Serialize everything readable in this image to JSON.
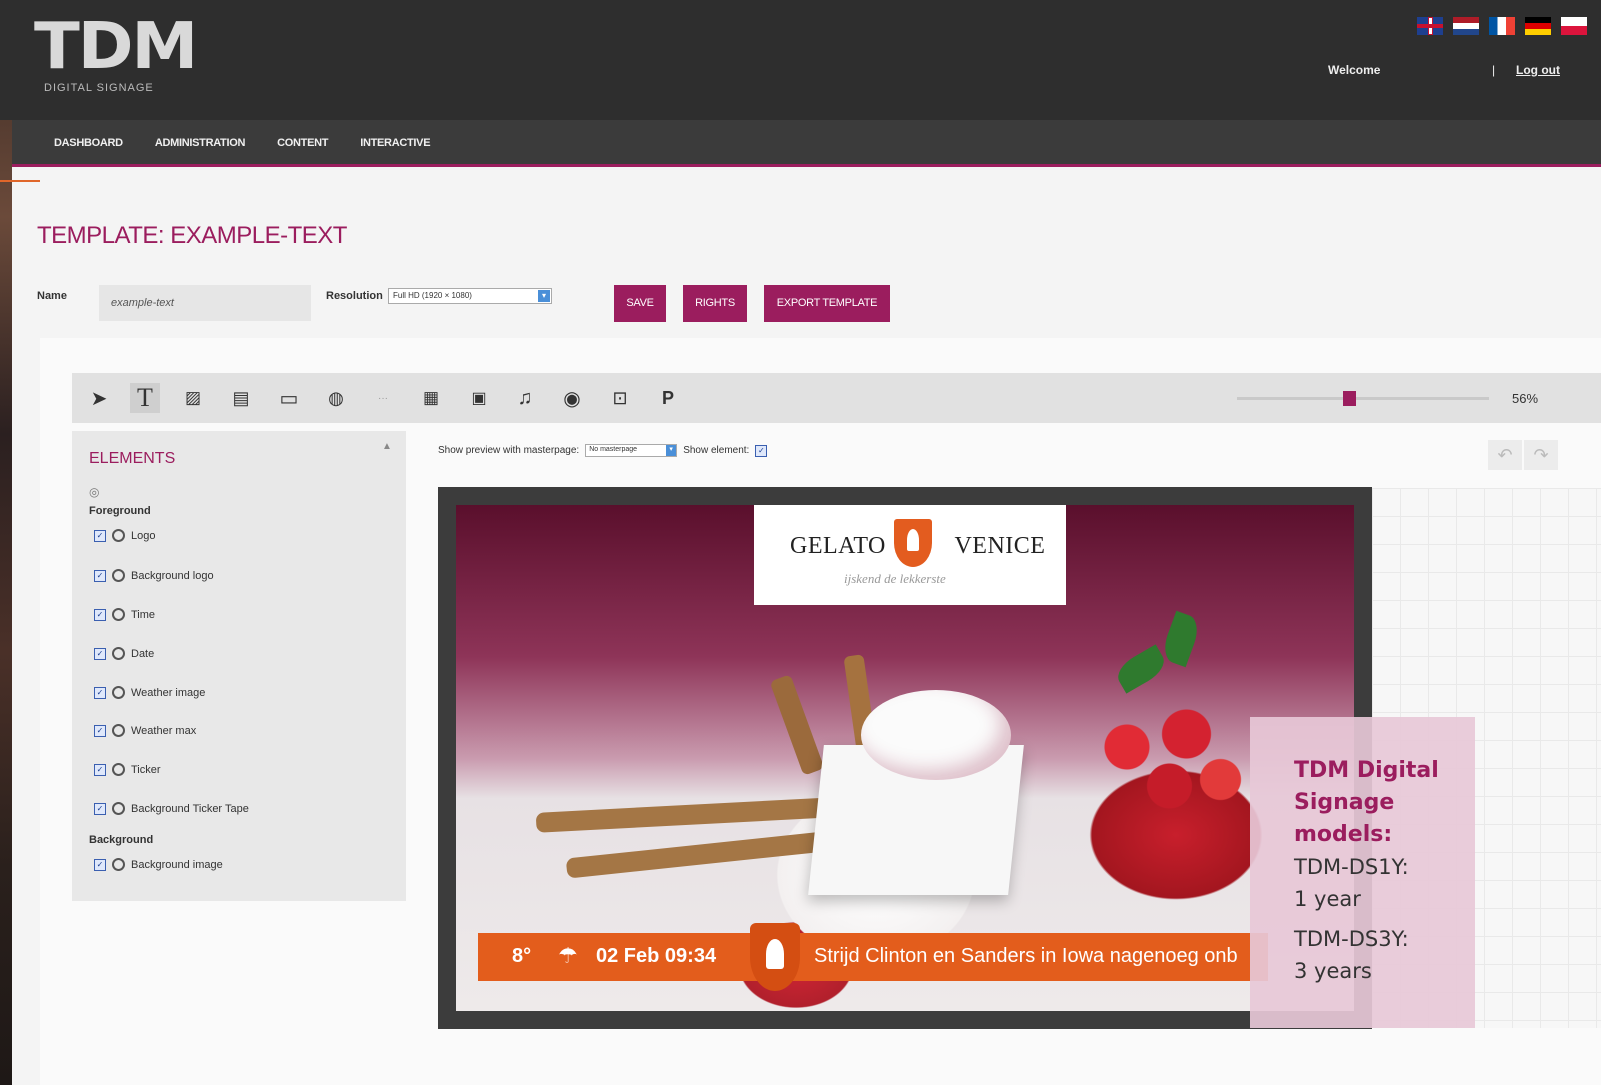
{
  "header": {
    "logo_text": "TDM",
    "logo_sub": "DIGITAL SIGNAGE",
    "welcome": "Welcome",
    "separator": "|",
    "logout": "Log out",
    "flags": [
      "uk-flag",
      "nl-flag",
      "fr-flag",
      "de-flag",
      "pl-flag"
    ]
  },
  "nav": {
    "items": [
      "DASHBOARD",
      "ADMINISTRATION",
      "CONTENT",
      "INTERACTIVE"
    ]
  },
  "page": {
    "title": "TEMPLATE: EXAMPLE-TEXT",
    "name_label": "Name",
    "name_value": "example-text",
    "resolution_label": "Resolution",
    "resolution_value": "Full HD (1920 × 1080)",
    "buttons": {
      "save": "SAVE",
      "rights": "RIGHTS",
      "export": "EXPORT TEMPLATE"
    }
  },
  "toolbar": {
    "tools": [
      "pointer-icon",
      "text-icon",
      "image-icon",
      "video-icon",
      "rectangle-icon",
      "web-icon",
      "ticker-icon",
      "calendar-icon",
      "youtube-icon",
      "music-icon",
      "rss-icon",
      "interactive-icon",
      "powerpoint-icon"
    ],
    "zoom": "56%",
    "zoom_value": 56
  },
  "elements_panel": {
    "title": "ELEMENTS",
    "foreground_label": "Foreground",
    "foreground_items": [
      "Logo",
      "Background logo",
      "Time",
      "Date",
      "Weather image",
      "Weather max",
      "Ticker",
      "Background Ticker Tape"
    ],
    "background_label": "Background",
    "background_items": [
      "Background image"
    ]
  },
  "preview": {
    "label": "Show preview with masterpage:",
    "masterpage_value": "No masterpage",
    "show_element_label": "Show element:"
  },
  "canvas": {
    "brand_left": "GELATO",
    "brand_right": "VENICE",
    "brand_tagline": "ijskend de lekkerste",
    "ticker_temp": "8°",
    "ticker_date": "02 Feb 09:34",
    "ticker_text": "Strijd Clinton en Sanders in Iowa nagenoeg onb"
  },
  "info_box": {
    "title": "TDM Digital Signage models:",
    "line1a": "TDM-DS1Y:",
    "line1b": "1 year",
    "line2a": "TDM-DS3Y:",
    "line2b": "3 years"
  },
  "colors": {
    "accent": "#9b1d5e",
    "ticker": "#e35d1c",
    "header_bg": "#2e2e2e"
  }
}
